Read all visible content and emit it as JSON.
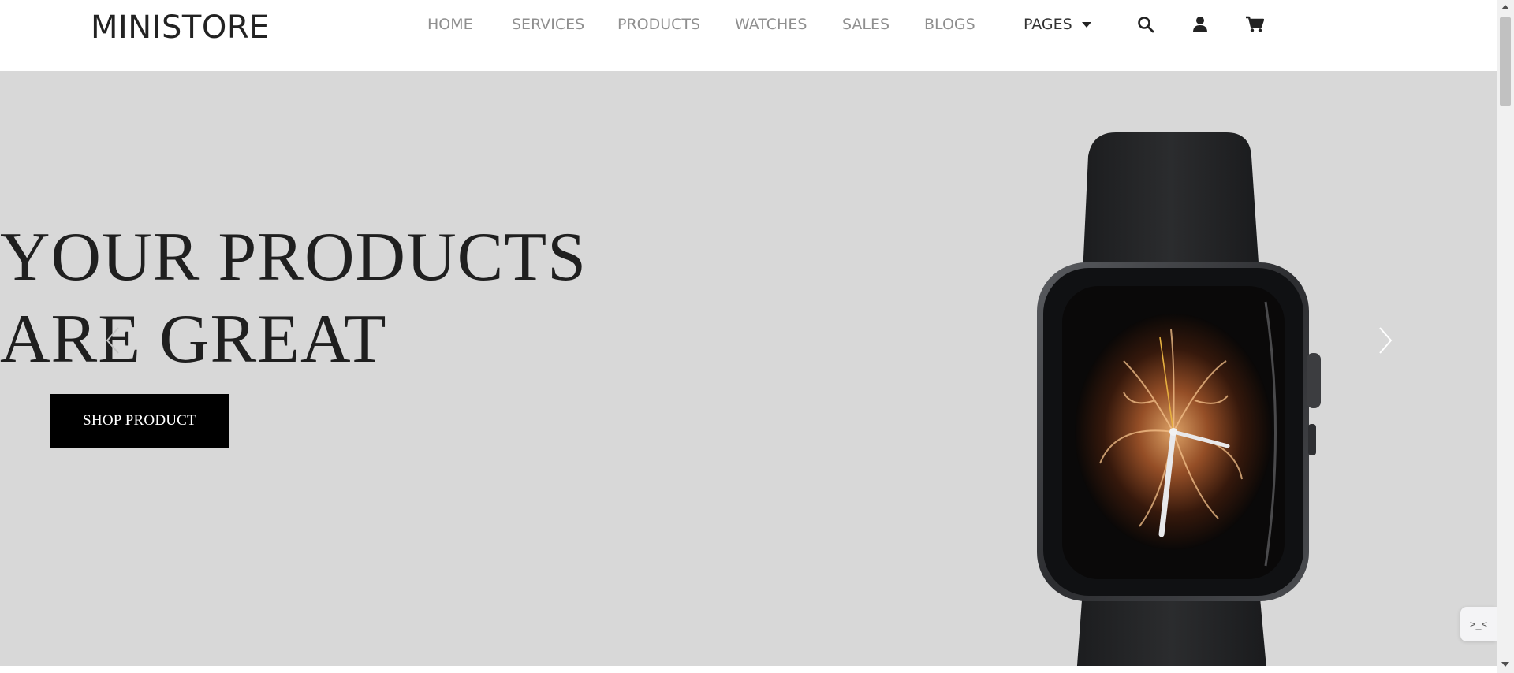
{
  "header": {
    "logo": "MINISTORE",
    "nav": [
      "HOME",
      "SERVICES",
      "PRODUCTS",
      "WATCHES",
      "SALES",
      "BLOGS"
    ],
    "pages_label": "PAGES",
    "icons": [
      "search-icon",
      "user-icon",
      "cart-icon"
    ]
  },
  "hero": {
    "title_line1": "YOUR PRODUCTS",
    "title_line2": "ARE GREAT",
    "button_label": "SHOP PRODUCT",
    "background_color": "#d8d8d8"
  },
  "widget": {
    "glyph": ">_<"
  },
  "colors": {
    "nav_text": "#8f8f8f",
    "title_text": "#1f1f1f",
    "button_bg": "#000000",
    "button_text": "#ffffff"
  }
}
